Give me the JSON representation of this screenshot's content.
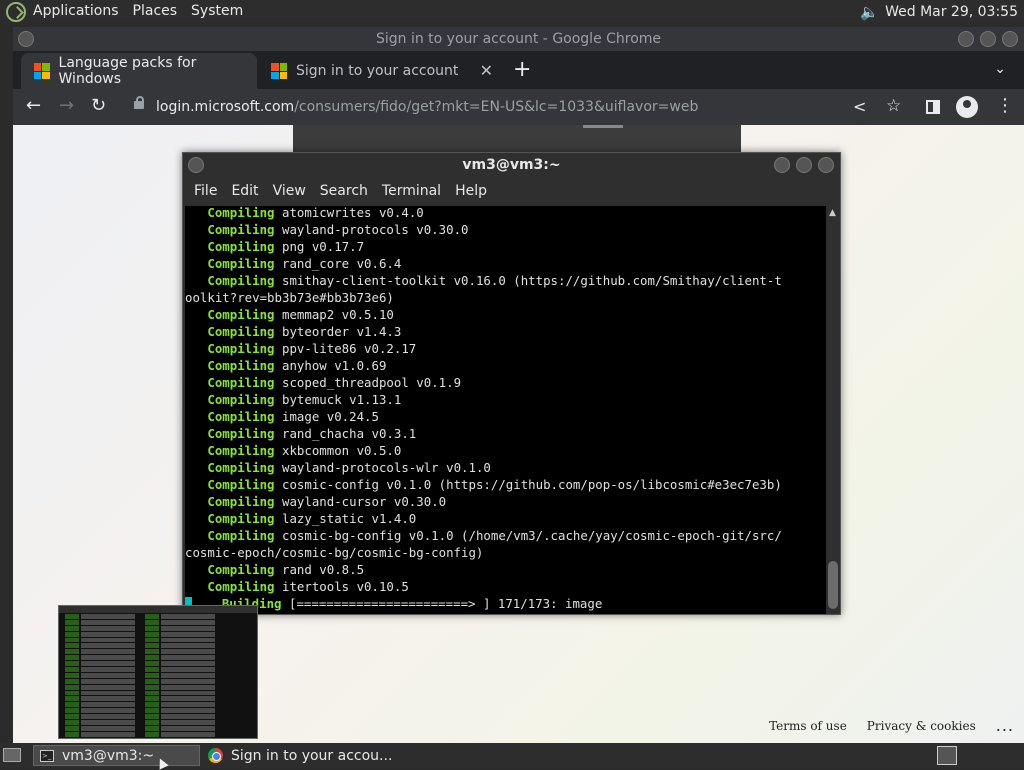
{
  "top_panel": {
    "menus": [
      "Applications",
      "Places",
      "System"
    ],
    "clock": "Wed Mar 29, 03:55"
  },
  "chrome": {
    "title": "Sign in to your account - Google Chrome",
    "tabs": [
      {
        "label": "Language packs for Windows"
      },
      {
        "label": "Sign in to your account"
      }
    ],
    "url_host": "login.microsoft.com",
    "url_rest": "/consumers/fido/get?mkt=EN-US&lc=1033&uiflavor=web"
  },
  "web_page": {
    "footer": {
      "terms": "Terms of use",
      "privacy": "Privacy & cookies",
      "more": "..."
    }
  },
  "terminal": {
    "title": "vm3@vm3:~",
    "menus": [
      "File",
      "Edit",
      "View",
      "Search",
      "Terminal",
      "Help"
    ],
    "lines": [
      {
        "kw": "   Compiling",
        "text": " atomicwrites v0.4.0"
      },
      {
        "kw": "   Compiling",
        "text": " wayland-protocols v0.30.0"
      },
      {
        "kw": "   Compiling",
        "text": " png v0.17.7"
      },
      {
        "kw": "   Compiling",
        "text": " rand_core v0.6.4"
      },
      {
        "kw": "   Compiling",
        "text": " smithay-client-toolkit v0.16.0 (https://github.com/Smithay/client-t"
      },
      {
        "kw": "",
        "text": "oolkit?rev=bb3b73e#bb3b73e6)"
      },
      {
        "kw": "   Compiling",
        "text": " memmap2 v0.5.10"
      },
      {
        "kw": "   Compiling",
        "text": " byteorder v1.4.3"
      },
      {
        "kw": "   Compiling",
        "text": " ppv-lite86 v0.2.17"
      },
      {
        "kw": "   Compiling",
        "text": " anyhow v1.0.69"
      },
      {
        "kw": "   Compiling",
        "text": " scoped_threadpool v0.1.9"
      },
      {
        "kw": "   Compiling",
        "text": " bytemuck v1.13.1"
      },
      {
        "kw": "   Compiling",
        "text": " image v0.24.5"
      },
      {
        "kw": "   Compiling",
        "text": " rand_chacha v0.3.1"
      },
      {
        "kw": "   Compiling",
        "text": " xkbcommon v0.5.0"
      },
      {
        "kw": "   Compiling",
        "text": " wayland-protocols-wlr v0.1.0"
      },
      {
        "kw": "   Compiling",
        "text": " cosmic-config v0.1.0 (https://github.com/pop-os/libcosmic#e3ec7e3b)"
      },
      {
        "kw": "   Compiling",
        "text": " wayland-cursor v0.30.0"
      },
      {
        "kw": "   Compiling",
        "text": " lazy_static v1.4.0"
      },
      {
        "kw": "   Compiling",
        "text": " cosmic-bg-config v0.1.0 (/home/vm3/.cache/yay/cosmic-epoch-git/src/"
      },
      {
        "kw": "",
        "text": "cosmic-epoch/cosmic-bg/cosmic-bg-config)"
      },
      {
        "kw": "   Compiling",
        "text": " rand v0.8.5"
      },
      {
        "kw": "   Compiling",
        "text": " itertools v0.10.5"
      },
      {
        "kw": "    Building",
        "text": " [=======================> ] 171/173: image"
      }
    ]
  },
  "taskbar": {
    "terminal_task": "vm3@vm3:~",
    "chrome_task": "Sign in to your accou..."
  }
}
